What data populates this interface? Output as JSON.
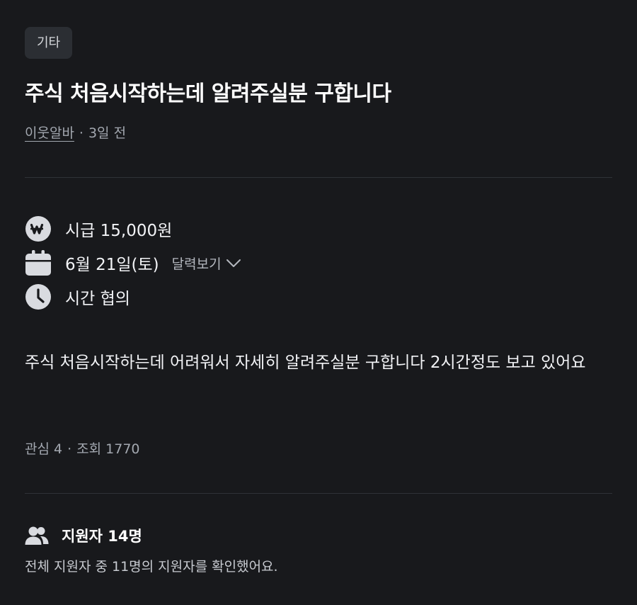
{
  "category": "기타",
  "title": "주식 처음시작하는데 알려주실분 구합니다",
  "meta": {
    "author": "이웃알바",
    "separator": "·",
    "posted": "3일 전"
  },
  "details": {
    "wage": "시급 15,000원",
    "date": "6월 21일(토)",
    "calendar_link": "달력보기",
    "time": "시간 협의"
  },
  "description": "주식 처음시작하는데 어려워서 자세히 알려주실분 구합니다 2시간정도 보고 있어요",
  "stats": {
    "interest": "관심 4",
    "separator": "·",
    "views": "조회 1770"
  },
  "applicants": {
    "title": "지원자 14명",
    "summary": "전체 지원자 중 11명의 지원자를 확인했어요."
  },
  "colors": {
    "background": "#18191c",
    "badge_bg": "#2b2e33",
    "icon_fill": "#d9dbe0",
    "muted_text": "#a3a8b0"
  }
}
